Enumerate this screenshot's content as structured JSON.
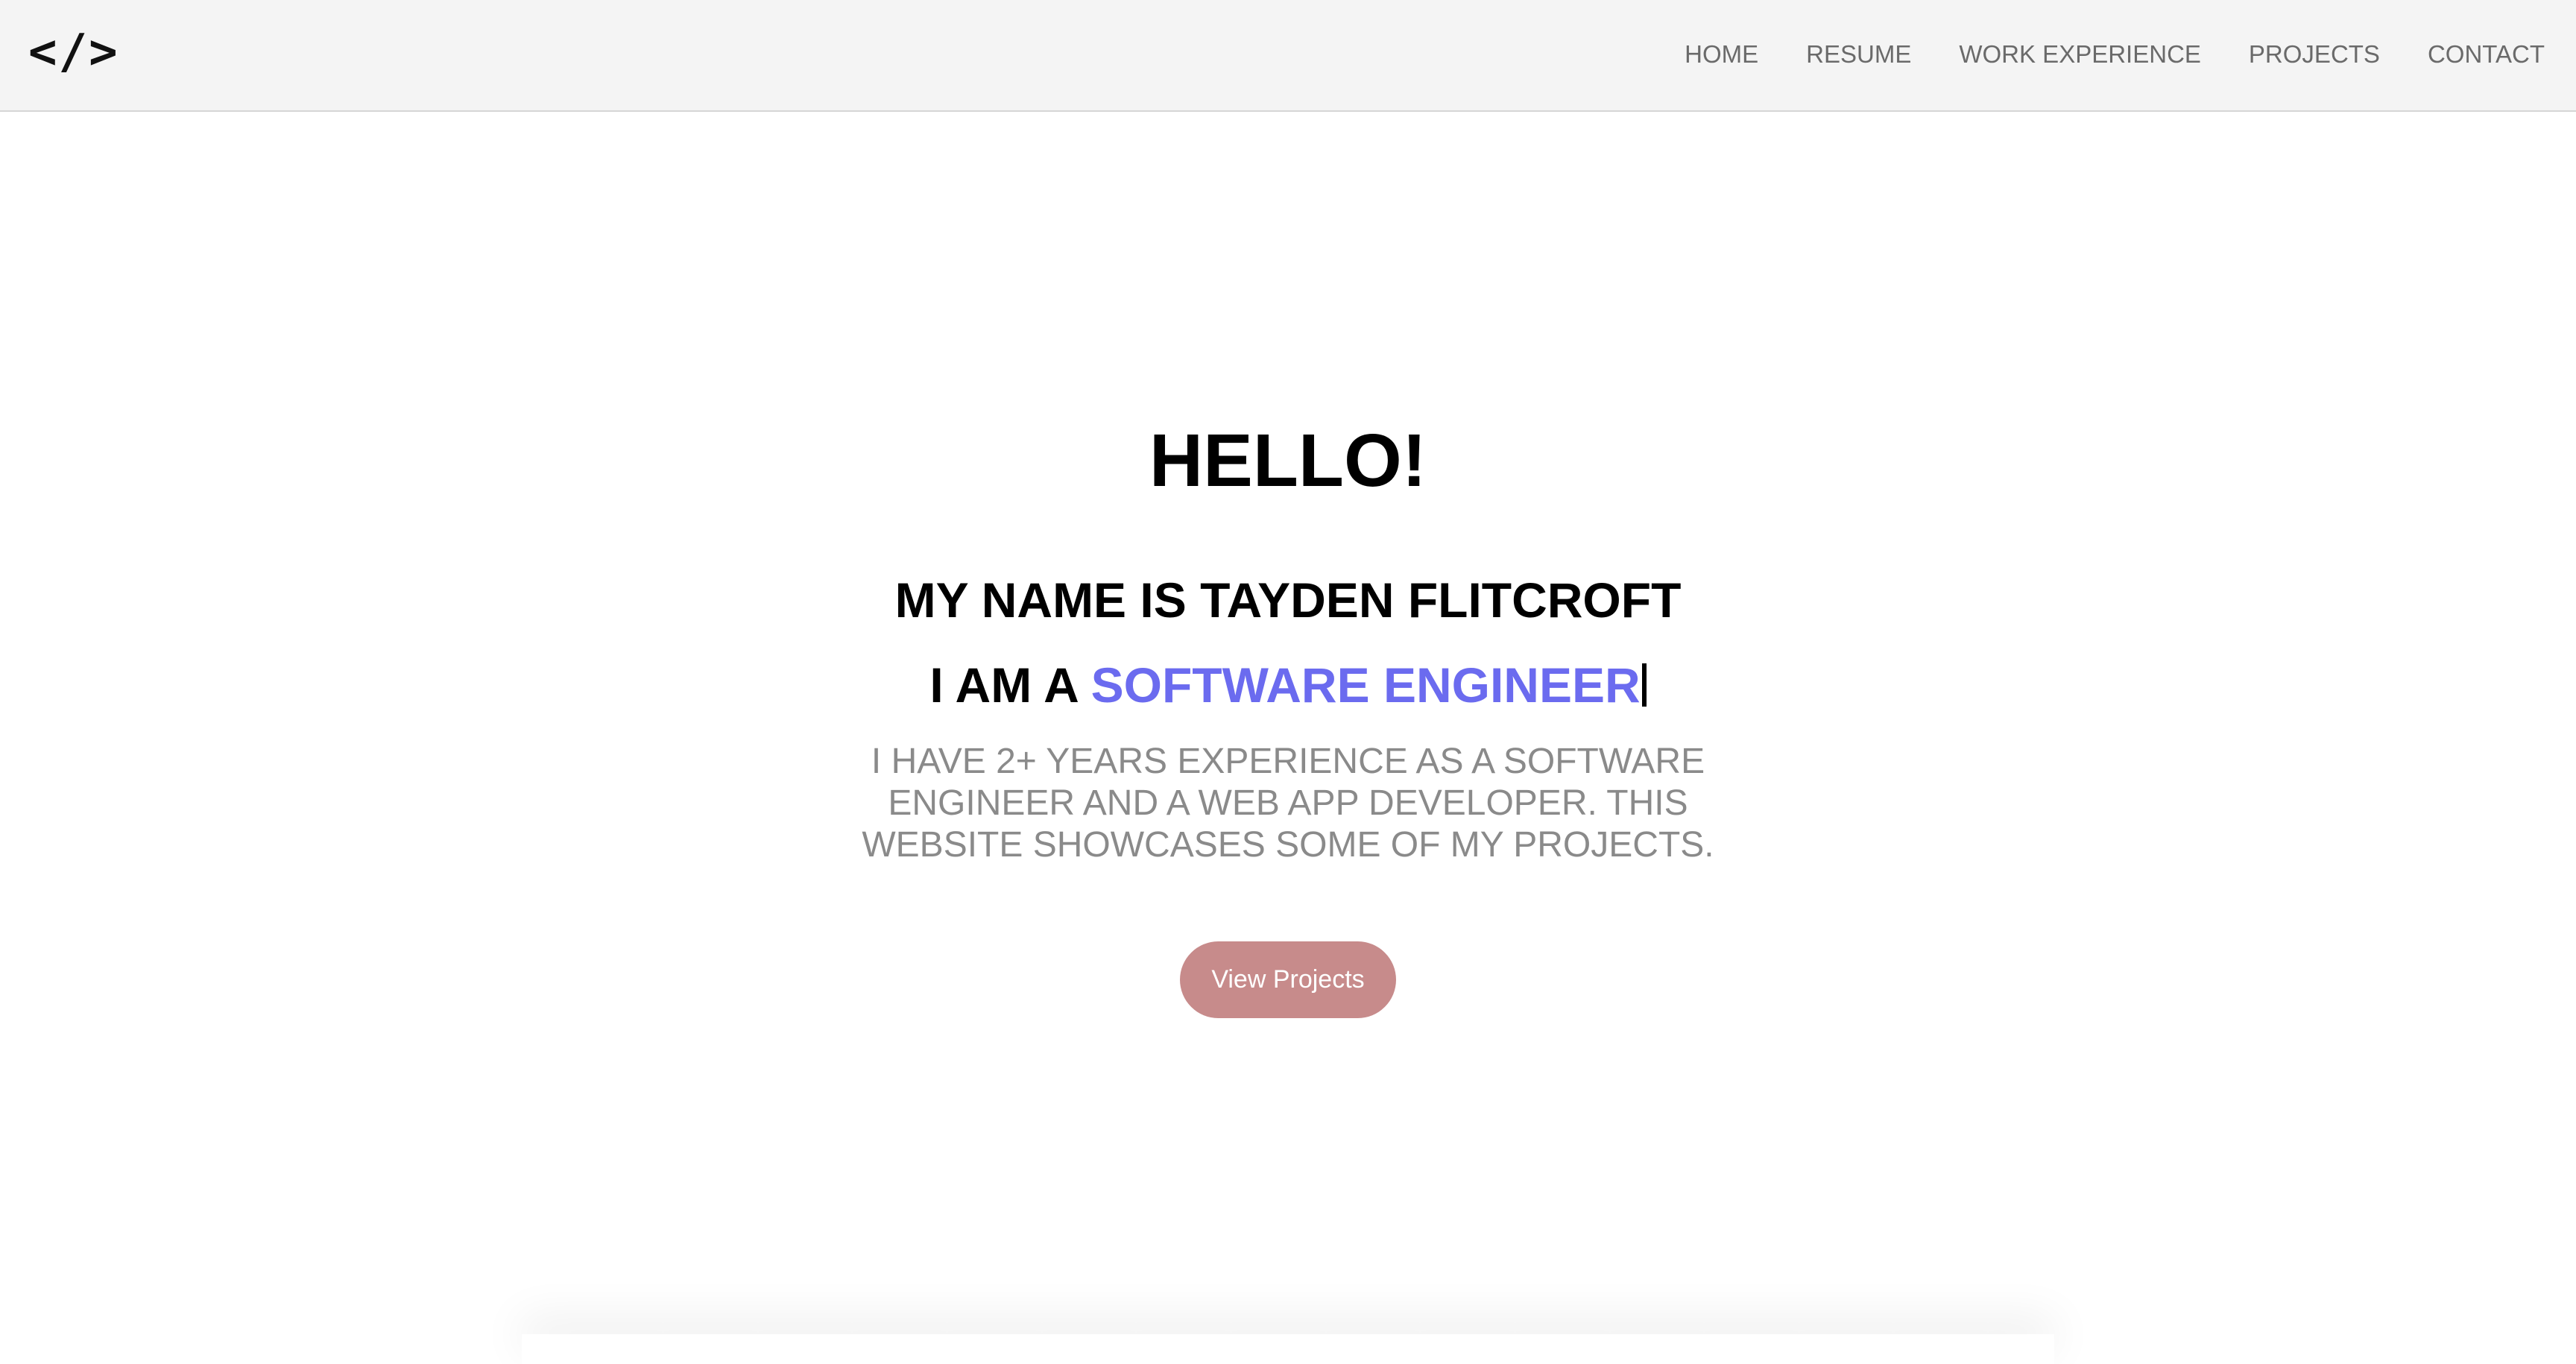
{
  "navbar": {
    "logo_text": "</>",
    "links": [
      {
        "label": "HOME"
      },
      {
        "label": "RESUME"
      },
      {
        "label": "WORK EXPERIENCE"
      },
      {
        "label": "PROJECTS"
      },
      {
        "label": "CONTACT"
      }
    ]
  },
  "hero": {
    "greeting": "HELLO!",
    "name_line": "MY NAME IS TAYDEN FLITCROFT",
    "role_prefix": "I AM A ",
    "role_highlight": "SOFTWARE ENGINEER",
    "description": "I HAVE 2+ YEARS EXPERIENCE AS A SOFTWARE ENGINEER AND A WEB APP DEVELOPER. THIS WEBSITE SHOWCASES SOME OF MY PROJECTS.",
    "cta_label": "View Projects"
  },
  "colors": {
    "navbar_bg": "#f4f4f4",
    "accent": "#6b6bef",
    "button_bg": "#c78b8b",
    "description_text": "#8a8a8a",
    "nav_text": "#6a6a6a"
  }
}
